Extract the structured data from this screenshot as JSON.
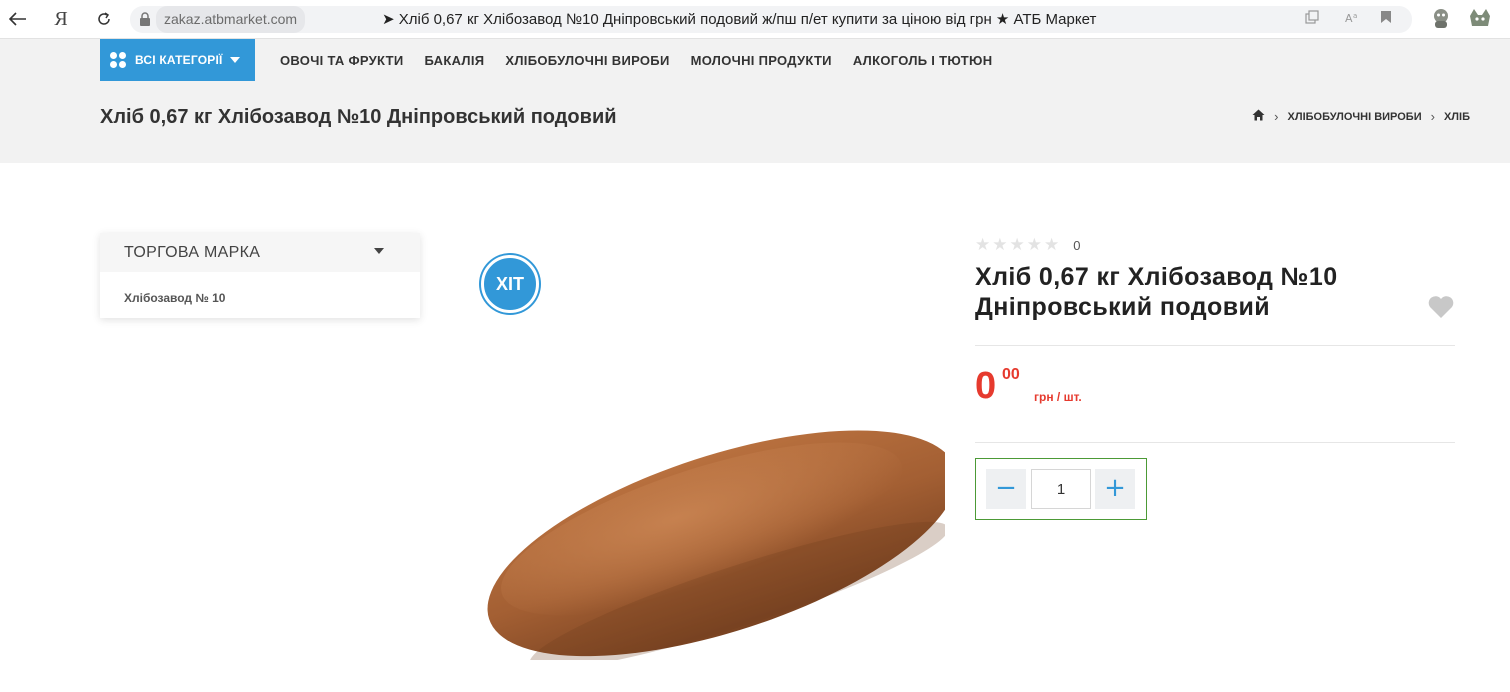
{
  "browser": {
    "domain": "zakaz.atbmarket.com",
    "tab_title": "➤ Хліб 0,67 кг Хлібозавод №10 Дніпровський подовий ж/пш п/ет купити за ціною від грн ★ АТБ Маркет",
    "yandex_label": "Я"
  },
  "nav": {
    "all_categories": "ВСІ КАТЕГОРІЇ",
    "items": [
      "ОВОЧІ ТА ФРУКТИ",
      "БАКАЛІЯ",
      "ХЛІБОБУЛОЧНІ ВИРОБИ",
      "МОЛОЧНІ ПРОДУКТИ",
      "АЛКОГОЛЬ І ТЮТЮН"
    ]
  },
  "page": {
    "title": "Хліб 0,67 кг Хлібозавод №10 Дніпровський подовий",
    "breadcrumbs": [
      "ХЛІБОБУЛОЧНІ ВИРОБИ",
      "ХЛІБ"
    ]
  },
  "filter": {
    "heading": "ТОРГОВА МАРКА",
    "items": [
      "Хлібозавод № 10"
    ]
  },
  "product": {
    "badge": "ХІТ",
    "rating_count": "0",
    "rating": 0,
    "title": "Хліб 0,67 кг Хлібозавод №10 Дніпровський подовий",
    "price_int": "0",
    "price_dec": "00",
    "price_unit": "грн / шт.",
    "quantity": "1",
    "minus": "−",
    "plus": "+"
  },
  "colors": {
    "accent": "#3298d8",
    "price": "#e63a2e",
    "qty_border": "#4c9a36"
  }
}
